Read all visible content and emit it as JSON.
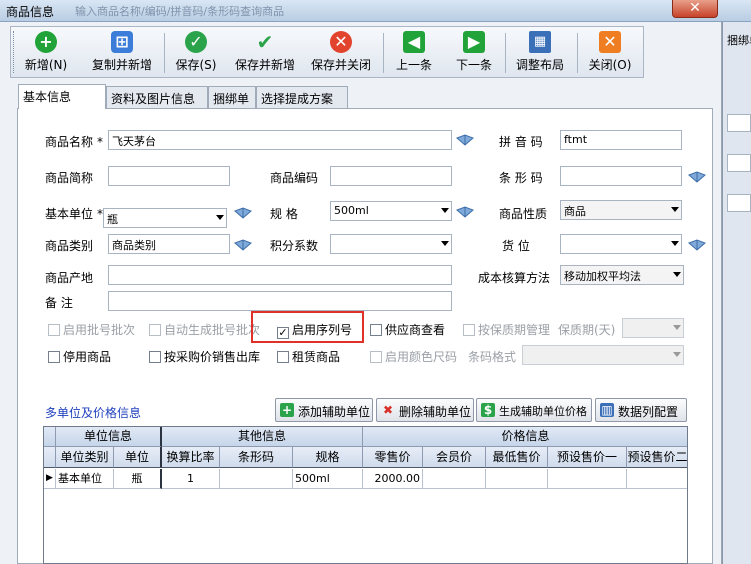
{
  "window": {
    "title": "商品信息",
    "background_text": "输入商品名称/编码/拼音码/条形码查询商品",
    "background_right_label": "捆绑单"
  },
  "toolbar": [
    {
      "label": "新增(N)",
      "icon": "plus-icon",
      "color": "#22a33a"
    },
    {
      "label": "复制并新增",
      "icon": "copy-icon",
      "color": "#3b7dd8"
    },
    {
      "label": "保存(S)",
      "icon": "check-icon",
      "color": "#2aa34a"
    },
    {
      "label": "保存并新增",
      "icon": "double-check-icon",
      "color": "#8a8fa0"
    },
    {
      "label": "保存并关闭",
      "icon": "x-circle-icon",
      "color": "#e2432d"
    },
    {
      "label": "上一条",
      "icon": "arrow-left-icon",
      "color": "#22a33a"
    },
    {
      "label": "下一条",
      "icon": "arrow-right-icon",
      "color": "#22a33a"
    },
    {
      "label": "调整布局",
      "icon": "grid-icon",
      "color": "#3b6fb8"
    },
    {
      "label": "关闭(O)",
      "icon": "close-icon",
      "color": "#ef7d22"
    }
  ],
  "tabs": [
    "基本信息",
    "资料及图片信息",
    "捆绑单",
    "选择提成方案"
  ],
  "form": {
    "product_name_label": "商品名称",
    "product_name_value": "飞天茅台",
    "pinyin_label": "拼 音 码",
    "pinyin_value": "ftmt",
    "short_name_label": "商品简称",
    "short_name_value": "",
    "code_label": "商品编码",
    "code_value": "",
    "barcode_label": "条 形 码",
    "barcode_value": "",
    "base_unit_label": "基本单位",
    "base_unit_value": "瓶",
    "spec_label": "规    格",
    "spec_value": "500ml",
    "nature_label": "商品性质",
    "nature_value": "商品",
    "category_label": "商品类别",
    "category_value": "商品类别",
    "points_label": "积分系数",
    "points_value": "",
    "location_label": "货    位",
    "location_value": "",
    "origin_label": "商品产地",
    "origin_value": "",
    "cost_method_label": "成本核算方法",
    "cost_method_value": "移动加权平均法",
    "remark_label": "备    注",
    "remark_value": "",
    "required_mark": "*"
  },
  "checks_row1": [
    {
      "label": "启用批号批次",
      "checked": false,
      "disabled": true
    },
    {
      "label": "自动生成批号批次",
      "checked": false,
      "disabled": true
    },
    {
      "label": "启用序列号",
      "checked": true,
      "disabled": false
    },
    {
      "label": "供应商查看",
      "checked": false,
      "disabled": false
    },
    {
      "label": "按保质期管理",
      "checked": false,
      "disabled": true
    }
  ],
  "shelf_life_label": "保质期(天)",
  "checks_row2": [
    {
      "label": "停用商品",
      "checked": false,
      "disabled": false
    },
    {
      "label": "按采购价销售出库",
      "checked": false,
      "disabled": false
    },
    {
      "label": "租赁商品",
      "checked": false,
      "disabled": false
    },
    {
      "label": "启用颜色尺码",
      "checked": false,
      "disabled": true
    }
  ],
  "barcode_format_label": "条码格式",
  "multi_unit": {
    "title": "多单位及价格信息",
    "buttons": [
      {
        "label": "添加辅助单位",
        "icon": "add-icon",
        "color": "#2aa34a"
      },
      {
        "label": "删除辅助单位",
        "icon": "delete-icon",
        "color": "#d9302a"
      },
      {
        "label": "生成辅助单位价格",
        "icon": "generate-icon",
        "color": "#2aa34a"
      },
      {
        "label": "数据列配置",
        "icon": "columns-icon",
        "color": "#3b6fb8"
      }
    ]
  },
  "grid": {
    "groups": [
      "单位信息",
      "其他信息",
      "价格信息"
    ],
    "columns": [
      "单位类别",
      "单位",
      "换算比率",
      "条形码",
      "规格",
      "零售价",
      "会员价",
      "最低售价",
      "预设售价一",
      "预设售价二"
    ],
    "rows": [
      [
        "基本单位",
        "瓶",
        "1",
        "",
        "500ml",
        "2000.00",
        "",
        "",
        "",
        ""
      ]
    ]
  }
}
